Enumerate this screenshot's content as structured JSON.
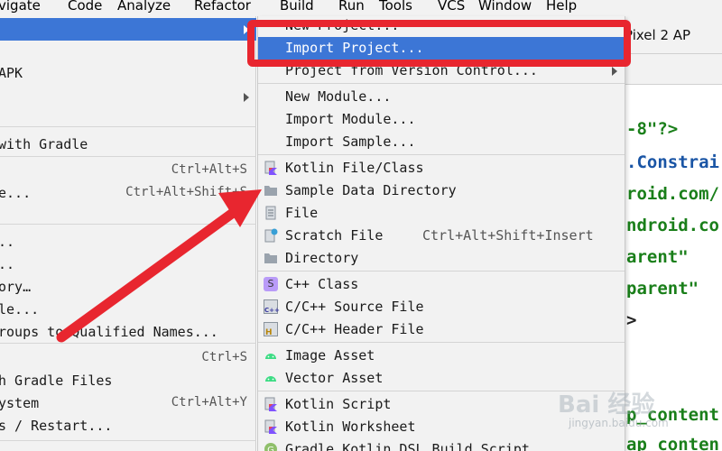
{
  "menubar": {
    "items": [
      "vigate",
      "Code",
      "Analyze",
      "Refactor",
      "Build",
      "Run",
      "Tools",
      "VCS",
      "Window",
      "Help"
    ]
  },
  "toolbar": {
    "device": "Pixel 2 AP"
  },
  "left_menu": {
    "items": [
      {
        "label": "",
        "shortcut": ""
      },
      {
        "label": " APK",
        "shortcut": ""
      },
      {
        "label": "",
        "shortcut": ""
      },
      {
        "label": " with Gradle",
        "shortcut": ""
      },
      {
        "label": "",
        "shortcut": "Ctrl+Alt+S"
      },
      {
        "label": "e...",
        "shortcut": "Ctrl+Alt+Shift+S"
      },
      {
        "label": "..",
        "shortcut": ""
      },
      {
        "label": "..",
        "shortcut": ""
      },
      {
        "label": "ory…",
        "shortcut": ""
      },
      {
        "label": "le...",
        "shortcut": ""
      },
      {
        "label": "roups to Qualified Names...",
        "shortcut": ""
      },
      {
        "label": "",
        "shortcut": "Ctrl+S"
      },
      {
        "label": "h Gradle Files",
        "shortcut": ""
      },
      {
        "label": "ystem",
        "shortcut": "Ctrl+Alt+Y"
      },
      {
        "label": "s / Restart...",
        "shortcut": ""
      }
    ]
  },
  "new_submenu": {
    "items": [
      {
        "label": "New Project...",
        "shortcut": ""
      },
      {
        "label": "Import Project...",
        "shortcut": ""
      },
      {
        "label": "Project from Version Control...",
        "shortcut": ""
      },
      {
        "label": "New Module...",
        "shortcut": ""
      },
      {
        "label": "Import Module...",
        "shortcut": ""
      },
      {
        "label": "Import Sample...",
        "shortcut": ""
      },
      {
        "label": "Kotlin File/Class",
        "shortcut": ""
      },
      {
        "label": "Sample Data Directory",
        "shortcut": ""
      },
      {
        "label": "File",
        "shortcut": ""
      },
      {
        "label": "Scratch File",
        "shortcut": "Ctrl+Alt+Shift+Insert"
      },
      {
        "label": "Directory",
        "shortcut": ""
      },
      {
        "label": "C++ Class",
        "shortcut": ""
      },
      {
        "label": "C/C++ Source File",
        "shortcut": ""
      },
      {
        "label": "C/C++ Header File",
        "shortcut": ""
      },
      {
        "label": "Image Asset",
        "shortcut": ""
      },
      {
        "label": "Vector Asset",
        "shortcut": ""
      },
      {
        "label": "Kotlin Script",
        "shortcut": ""
      },
      {
        "label": "Kotlin Worksheet",
        "shortcut": ""
      },
      {
        "label": "Gradle Kotlin DSL Build Script",
        "shortcut": ""
      }
    ],
    "icon_glyphs": {
      "cpp_class": "S",
      "cpp_source": "C++",
      "cpp_header": "H"
    }
  },
  "editor": {
    "lines": [
      "-8\"?>",
      ".Constrai",
      "roid.com/",
      "ndroid.co",
      "arent\"",
      "parent\"",
      ">",
      "",
      "p_content",
      "ap_conten"
    ]
  },
  "watermark": {
    "text": "Bai 经验",
    "sub": "jingyan.baidu.com"
  },
  "colors": {
    "selection": "#3c76d6",
    "annotation": "#e8262f",
    "code_green": "#1a7f1a",
    "code_blue": "#1a55a5",
    "android_green": "#3ddc84"
  }
}
